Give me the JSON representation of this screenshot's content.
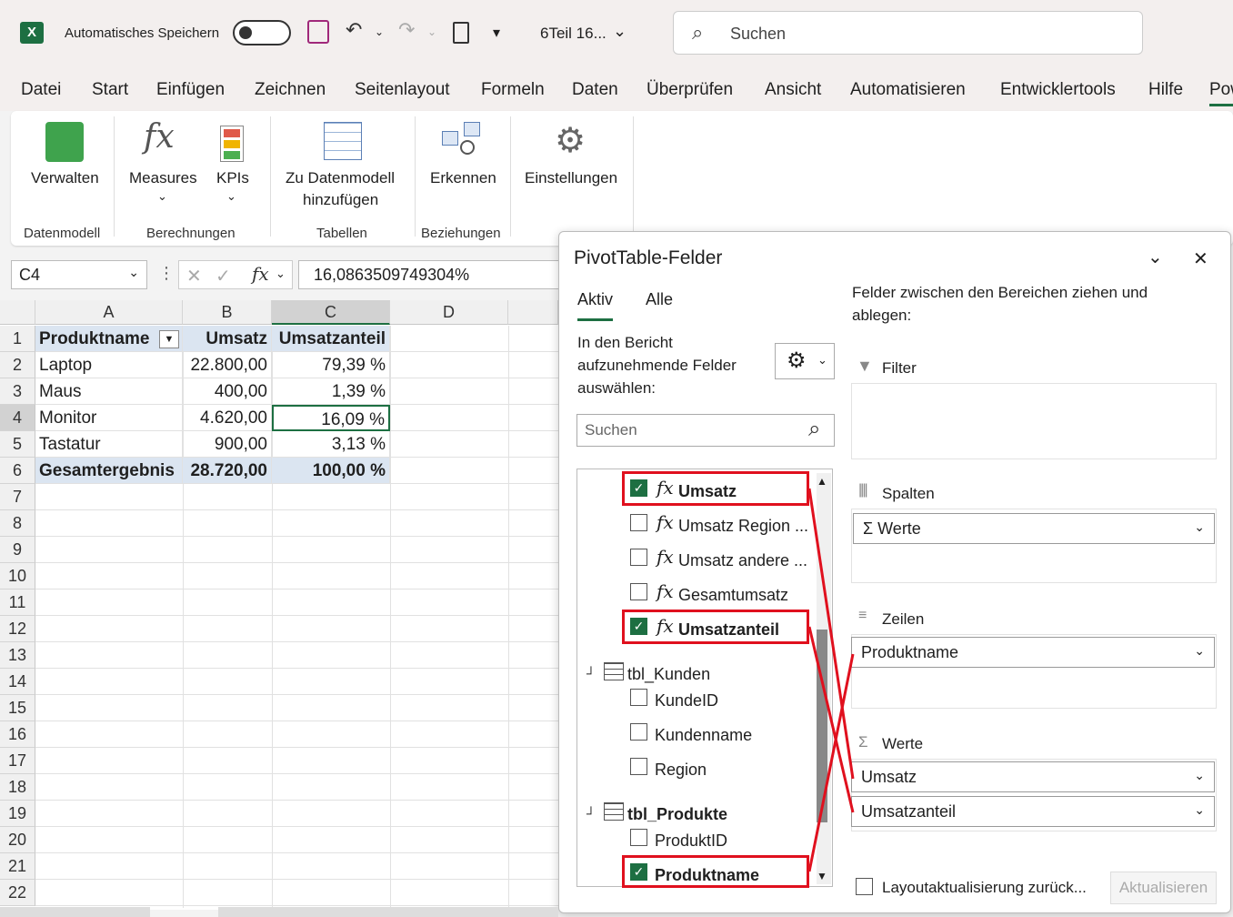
{
  "app": {
    "logo": "X",
    "autosave_label": "Automatisches Speichern",
    "doc_title": "6Teil 16...",
    "search_placeholder": "Suchen"
  },
  "menu": [
    "Datei",
    "Start",
    "Einfügen",
    "Zeichnen",
    "Seitenlayout",
    "Formeln",
    "Daten",
    "Überprüfen",
    "Ansicht",
    "Automatisieren",
    "Entwicklertools",
    "Hilfe",
    "Pow"
  ],
  "ribbon": {
    "buttons": {
      "verwalten": "Verwalten",
      "measures": "Measures",
      "kpis": "KPIs",
      "zu_datenmodell_1": "Zu Datenmodell",
      "zu_datenmodell_2": "hinzufügen",
      "erkennen": "Erkennen",
      "einstellungen": "Einstellungen"
    },
    "groups": {
      "datenmodell": "Datenmodell",
      "berechnungen": "Berechnungen",
      "tabellen": "Tabellen",
      "beziehungen": "Beziehungen"
    }
  },
  "formula": {
    "namebox": "C4",
    "value": "16,0863509749304%"
  },
  "grid": {
    "columns": [
      "A",
      "B",
      "C",
      "D"
    ],
    "rows": [
      "1",
      "2",
      "3",
      "4",
      "5",
      "6",
      "7",
      "8",
      "9",
      "10",
      "11",
      "12",
      "13",
      "14",
      "15",
      "16",
      "17",
      "18",
      "19",
      "20",
      "21",
      "22"
    ],
    "header": [
      "Produktname",
      "Umsatz",
      "Umsatzanteil"
    ],
    "data": [
      [
        "Laptop",
        "22.800,00",
        "79,39 %"
      ],
      [
        "Maus",
        "400,00",
        "1,39 %"
      ],
      [
        "Monitor",
        "4.620,00",
        "16,09 %"
      ],
      [
        "Tastatur",
        "900,00",
        "3,13 %"
      ]
    ],
    "total": [
      "Gesamtergebnis",
      "28.720,00",
      "100,00 %"
    ]
  },
  "pivot": {
    "title": "PivotTable-Felder",
    "tab_active": "Aktiv",
    "tab_all": "Alle",
    "choose_1": "In den Bericht",
    "choose_2": "aufzunehmende Felder",
    "choose_3": "auswählen:",
    "search_placeholder": "Suchen",
    "drag_hint_1": "Felder zwischen den Bereichen ziehen und",
    "drag_hint_2": "ablegen:",
    "fields": {
      "umsatz": "Umsatz",
      "umsatz_region": "Umsatz Region ...",
      "umsatz_andere": "Umsatz andere ...",
      "gesamtumsatz": "Gesamtumsatz",
      "umsatzanteil": "Umsatzanteil",
      "tbl_kunden": "tbl_Kunden",
      "kundeid": "KundeID",
      "kundenname": "Kundenname",
      "region": "Region",
      "tbl_produkte": "tbl_Produkte",
      "produktid": "ProduktID",
      "produktname": "Produktname"
    },
    "areas": {
      "filter": "Filter",
      "spalten": "Spalten",
      "spalten_item": "Werte",
      "zeilen": "Zeilen",
      "zeilen_item": "Produktname",
      "werte": "Werte",
      "werte_item_1": "Umsatz",
      "werte_item_2": "Umsatzanteil"
    },
    "defer_label": "Layoutaktualisierung zurück...",
    "update_button": "Aktualisieren"
  },
  "colors": {
    "excel_green": "#1d6f42",
    "highlight_red": "#e0101e",
    "table_header": "#dbe5f1"
  }
}
